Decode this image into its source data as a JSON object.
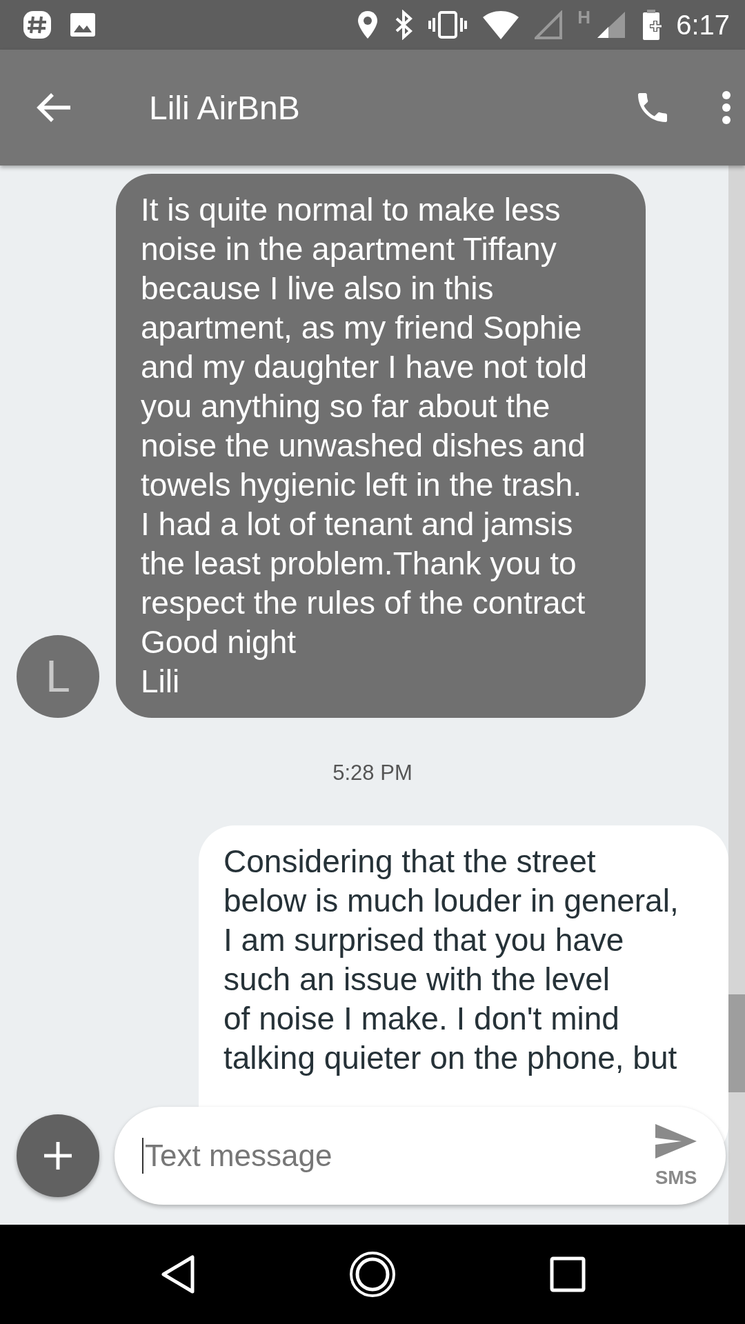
{
  "status_bar": {
    "network_type": "H",
    "time": "6:17"
  },
  "app_bar": {
    "title": "Lili AirBnB"
  },
  "messages": [
    {
      "kind": "incoming",
      "avatar_letter": "L",
      "lines": [
        "It is quite normal to make less",
        "noise in the apartment Tiffany",
        "because I live also in this",
        "apartment, as my friend Sophie",
        "and my daughter I have not told",
        "you anything so far about the",
        "noise the unwashed dishes and",
        "towels hygienic left in the trash.",
        "I had a lot of tenant and jamsis",
        "the least problem.Thank you to",
        "respect the rules of the contract",
        "Good night",
        "Lili"
      ]
    },
    {
      "kind": "timestamp",
      "text": "5:28 PM"
    },
    {
      "kind": "outgoing",
      "lines": [
        "Considering that the street",
        "below is much louder in general,",
        "I am surprised that you have",
        "such an issue with the level",
        "of noise I make. I don't mind",
        "talking quieter on the phone, but"
      ]
    }
  ],
  "compose": {
    "placeholder": "Text message",
    "send_label": "SMS"
  }
}
